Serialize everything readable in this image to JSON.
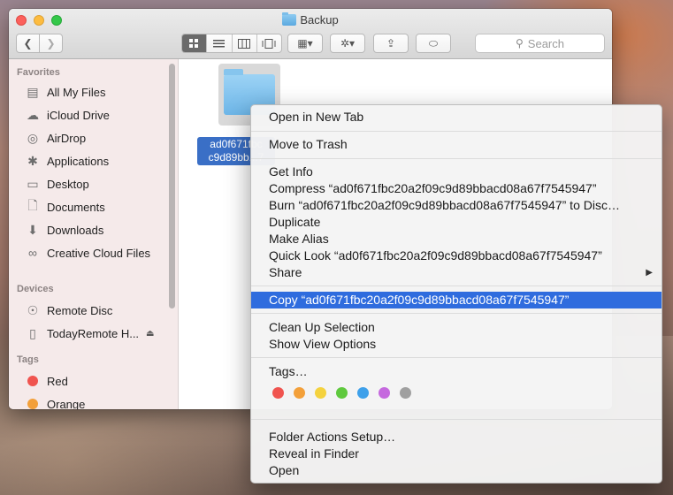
{
  "window": {
    "title": "Backup",
    "search_placeholder": "Search",
    "view_modes": [
      "icon-view-icon",
      "list-view-icon",
      "column-view-icon",
      "cover-flow-icon"
    ],
    "arrange_icon": "▦▾",
    "action_icon": "✲▾",
    "share_icon": "⇪",
    "tag_icon": "⬭"
  },
  "sidebar": {
    "favorites_header": "Favorites",
    "favorites": [
      {
        "label": "All My Files",
        "icon": "all-my-files-icon"
      },
      {
        "label": "iCloud Drive",
        "icon": "icloud-icon"
      },
      {
        "label": "AirDrop",
        "icon": "airdrop-icon"
      },
      {
        "label": "Applications",
        "icon": "applications-icon"
      },
      {
        "label": "Desktop",
        "icon": "desktop-icon"
      },
      {
        "label": "Documents",
        "icon": "documents-icon"
      },
      {
        "label": "Downloads",
        "icon": "downloads-icon"
      },
      {
        "label": "Creative Cloud Files",
        "icon": "creative-cloud-icon"
      }
    ],
    "devices_header": "Devices",
    "devices": [
      {
        "label": "Remote Disc",
        "icon": "disc-icon"
      },
      {
        "label": "TodayRemote H...",
        "icon": "drive-icon"
      }
    ],
    "tags_header": "Tags",
    "tags": [
      {
        "label": "Red",
        "color": "#f0544f"
      },
      {
        "label": "Orange",
        "color": "#f3a03a"
      }
    ]
  },
  "file": {
    "name_line1": "ad0f671fbc",
    "name_line2": "c9d89bb...7"
  },
  "context_menu": {
    "open_new_tab": "Open in New Tab",
    "move_to_trash": "Move to Trash",
    "get_info": "Get Info",
    "compress": "Compress “ad0f671fbc20a2f09c9d89bbacd08a67f7545947”",
    "burn": "Burn “ad0f671fbc20a2f09c9d89bbacd08a67f7545947” to Disc…",
    "duplicate": "Duplicate",
    "make_alias": "Make Alias",
    "quick_look": "Quick Look “ad0f671fbc20a2f09c9d89bbacd08a67f7545947”",
    "share": "Share",
    "copy": "Copy “ad0f671fbc20a2f09c9d89bbacd08a67f7545947”",
    "clean_up": "Clean Up Selection",
    "show_view_options": "Show View Options",
    "tags": "Tags…",
    "tag_colors": [
      "#f0544f",
      "#f3a03a",
      "#f4d23e",
      "#5fc93e",
      "#3ea0ea",
      "#c569de",
      "#a0a0a0"
    ],
    "folder_actions": "Folder Actions Setup…",
    "reveal": "Reveal in Finder",
    "open": "Open"
  }
}
